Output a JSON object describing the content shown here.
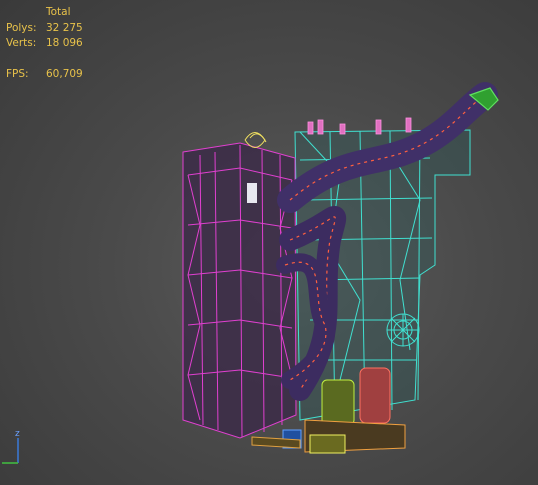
{
  "stats": {
    "header": "Total",
    "polys_label": "Polys:",
    "polys_value": "32 275",
    "verts_label": "Verts:",
    "verts_value": "18 096",
    "fps_label": "FPS:",
    "fps_value": "60,709"
  },
  "gizmo": {
    "z_label": "z"
  },
  "colors": {
    "stats_text": "#e8c24a",
    "block_wire": "#e040d0",
    "frame_wire": "#40e0d0",
    "pipe_wire": "#ff6040",
    "axis_blue": "#3a7ad8",
    "axis_green": "#40c040"
  }
}
